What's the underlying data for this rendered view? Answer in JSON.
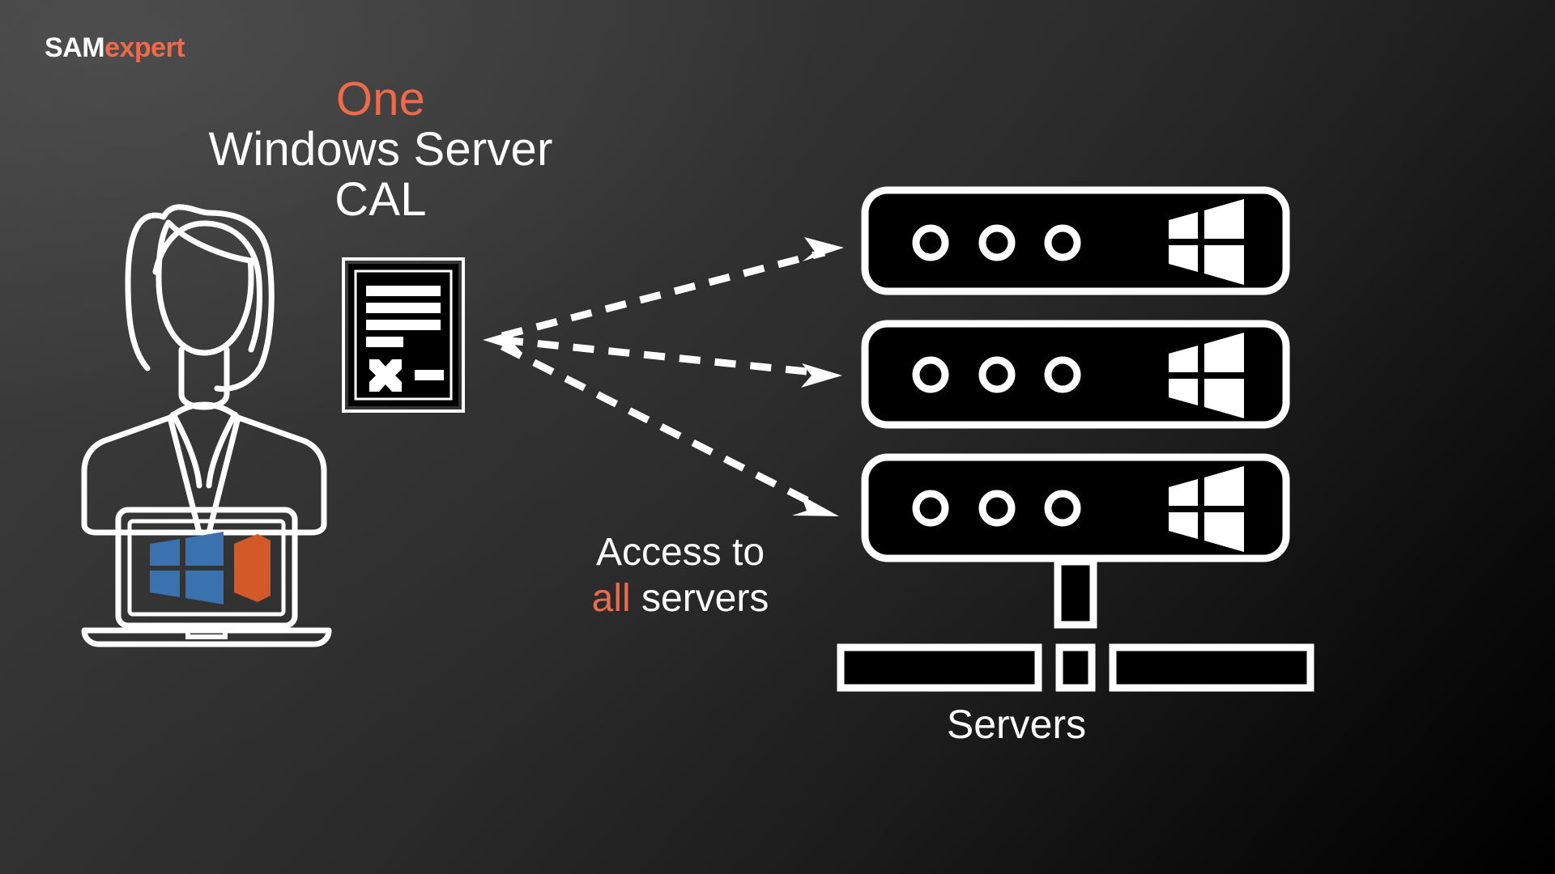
{
  "slide": {
    "background_start": "#3f3f3f",
    "background_end": "#000000",
    "accent_color": "#ED6B4A",
    "text_color": "#FFFFFF"
  },
  "logo": {
    "part1": "SAM",
    "part2": "expert",
    "part1_color": "#FFFFFF",
    "part2_color": "#ED6B4A"
  },
  "headline": {
    "line1": "One",
    "line1_color": "#ED6B4A",
    "line2": "Windows Server",
    "line3": "CAL"
  },
  "access_caption": {
    "line1": "Access to",
    "highlight": "all",
    "highlight_color": "#ED6B4A",
    "line2_rest": " servers"
  },
  "servers_caption": {
    "label": "Servers"
  },
  "icons": {
    "user": "businesswoman-icon",
    "license": "license-document-icon",
    "laptop": "laptop-icon",
    "windows_on_laptop": "windows-logo-icon",
    "office_on_laptop": "office-logo-icon",
    "server_1": "server-unit-icon",
    "server_2": "server-unit-icon",
    "server_3": "server-unit-icon",
    "rack_base": "server-rack-base-icon",
    "arrow_1": "dashed-arrow-icon",
    "arrow_2": "dashed-arrow-icon",
    "arrow_3": "dashed-arrow-icon",
    "arrow_back": "dashed-arrow-head-left-icon"
  },
  "colors": {
    "windows_blue": "#3A72B0",
    "windows_blue_dark": "#2F5F94",
    "office_orange": "#D35A28",
    "office_orange_dark": "#B94A1E",
    "server_fill": "#000000",
    "server_stroke": "#FFFFFF",
    "line_art": "#FFFFFF"
  },
  "server_units": [
    {
      "name": "server-unit-1",
      "leds": 3,
      "os_logo": "windows"
    },
    {
      "name": "server-unit-2",
      "leds": 3,
      "os_logo": "windows"
    },
    {
      "name": "server-unit-3",
      "leds": 3,
      "os_logo": "windows"
    }
  ]
}
